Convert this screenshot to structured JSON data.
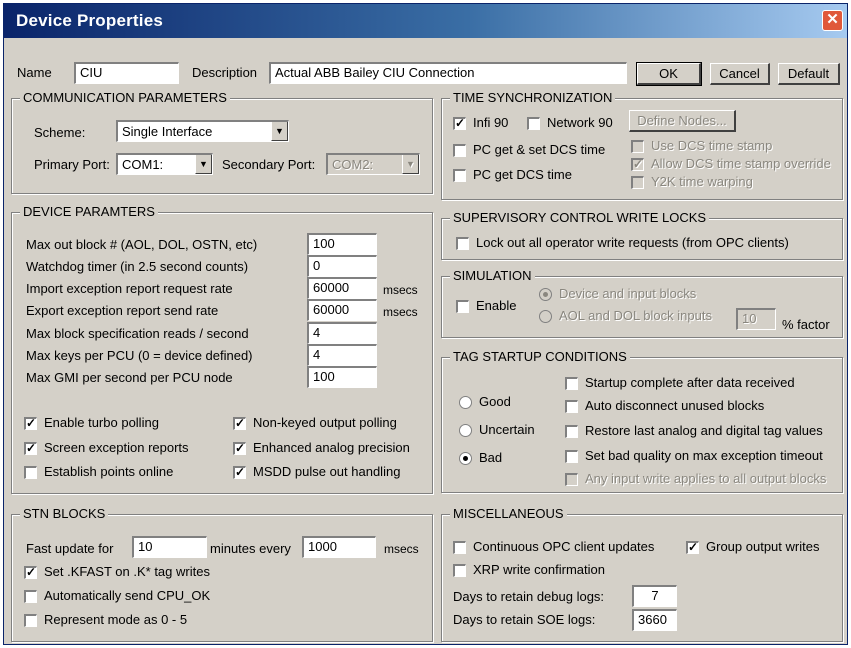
{
  "window": {
    "title": "Device Properties",
    "close_glyph": "✕"
  },
  "header": {
    "name_label": "Name",
    "name_value": "CIU",
    "description_label": "Description",
    "description_value": "Actual ABB Bailey CIU Connection",
    "ok": "OK",
    "cancel": "Cancel",
    "default": "Default"
  },
  "comm": {
    "title": "COMMUNICATION PARAMETERS",
    "scheme_label": "Scheme:",
    "scheme_value": "Single Interface",
    "primary_label": "Primary Port:",
    "primary_value": "COM1:",
    "secondary_label": "Secondary Port:",
    "secondary_value": "COM2:"
  },
  "device": {
    "title": "DEVICE PARAMTERS",
    "rows": [
      {
        "label": "Max out block # (AOL, DOL, OSTN, etc)",
        "value": "100",
        "unit": ""
      },
      {
        "label": "Watchdog timer (in 2.5 second counts)",
        "value": "0",
        "unit": ""
      },
      {
        "label": "Import exception report request rate",
        "value": "60000",
        "unit": "msecs"
      },
      {
        "label": "Export exception report send rate",
        "value": "60000",
        "unit": "msecs"
      },
      {
        "label": "Max block specification reads / second",
        "value": "4",
        "unit": ""
      },
      {
        "label": "Max keys per PCU (0 = device defined)",
        "value": "4",
        "unit": ""
      },
      {
        "label": "Max GMI per second per PCU node",
        "value": "100",
        "unit": ""
      }
    ],
    "checks": [
      {
        "label": "Enable turbo polling",
        "checked": true
      },
      {
        "label": "Non-keyed output polling",
        "checked": true
      },
      {
        "label": "Screen exception reports",
        "checked": true
      },
      {
        "label": "Enhanced analog precision",
        "checked": true
      },
      {
        "label": "Establish points online",
        "checked": false
      },
      {
        "label": "MSDD pulse out handling",
        "checked": true
      }
    ]
  },
  "stn": {
    "title": "STN BLOCKS",
    "fast_label": "Fast update for",
    "fast_value": "10",
    "minutes_label": "minutes every",
    "every_value": "1000",
    "unit": "msecs",
    "checks": [
      {
        "label": "Set .KFAST on .K* tag writes",
        "checked": true
      },
      {
        "label": "Automatically send CPU_OK",
        "checked": false
      },
      {
        "label": "Represent mode as 0 - 5",
        "checked": false
      }
    ]
  },
  "time": {
    "title": "TIME SYNCHRONIZATION",
    "infi90": {
      "label": "Infi 90",
      "checked": true
    },
    "network90": {
      "label": "Network 90",
      "checked": false
    },
    "define_nodes": "Define Nodes...",
    "pc_get_set": {
      "label": "PC get & set DCS time",
      "checked": false
    },
    "pc_get": {
      "label": "PC get DCS time",
      "checked": false
    },
    "use_dcs": {
      "label": "Use DCS time stamp",
      "checked": false
    },
    "allow_override": {
      "label": "Allow DCS time stamp override",
      "checked": true
    },
    "y2k": {
      "label": "Y2K time warping",
      "checked": false
    }
  },
  "supervisory": {
    "title": "SUPERVISORY CONTROL WRITE LOCKS",
    "lock": {
      "label": "Lock out all operator write requests (from OPC clients)",
      "checked": false
    }
  },
  "simulation": {
    "title": "SIMULATION",
    "enable": {
      "label": "Enable",
      "checked": false
    },
    "device_input": {
      "label": "Device and input blocks",
      "selected": true
    },
    "aol_dol": {
      "label": "AOL and DOL block inputs",
      "selected": false
    },
    "factor_value": "10",
    "factor_label": "% factor"
  },
  "tag": {
    "title": "TAG STARTUP CONDITIONS",
    "radios": [
      {
        "label": "Good",
        "selected": false
      },
      {
        "label": "Uncertain",
        "selected": false
      },
      {
        "label": "Bad",
        "selected": true
      }
    ],
    "checks": [
      {
        "label": "Startup complete after data received",
        "checked": false
      },
      {
        "label": "Auto disconnect unused blocks",
        "checked": false
      },
      {
        "label": "Restore last analog and digital tag values",
        "checked": false
      },
      {
        "label": "Set bad quality on max exception timeout",
        "checked": false
      },
      {
        "label": "Any input write applies to all output blocks",
        "checked": false
      }
    ]
  },
  "misc": {
    "title": "MISCELLANEOUS",
    "continuous": {
      "label": "Continuous OPC client updates",
      "checked": false
    },
    "group_writes": {
      "label": "Group output writes",
      "checked": true
    },
    "xrp": {
      "label": "XRP write confirmation",
      "checked": false
    },
    "debug_label": "Days to retain debug logs:",
    "debug_value": "7",
    "soe_label": "Days to retain SOE logs:",
    "soe_value": "3660"
  },
  "glyphs": {
    "check": "✓",
    "arrow": "▼"
  }
}
